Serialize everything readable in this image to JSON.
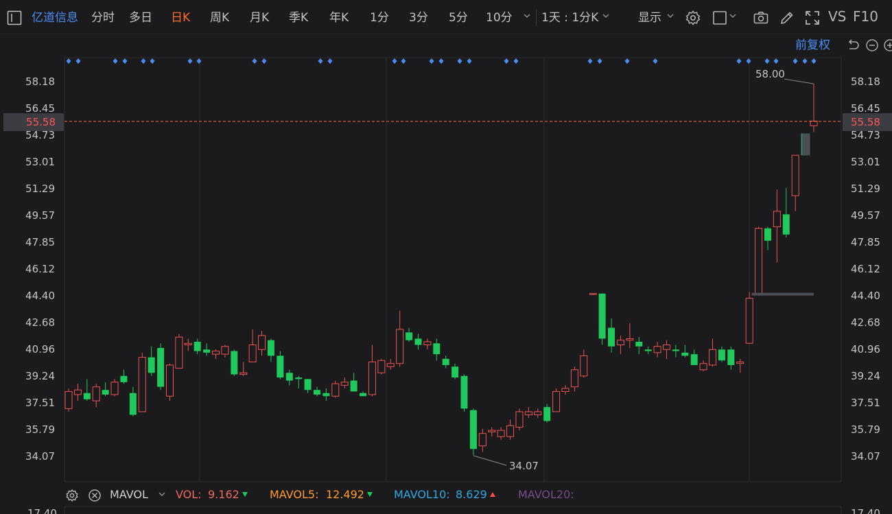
{
  "toolbar": {
    "stock_name": "亿道信息",
    "tabs": [
      "分时",
      "多日",
      "日K",
      "周K",
      "月K",
      "季K",
      "年K",
      "1分",
      "3分",
      "5分",
      "10分"
    ],
    "active_tab": "日K",
    "period_select": "1天 : 1分K",
    "display_label": "显示",
    "vs_label": "VS",
    "f10_label": "F10"
  },
  "chart": {
    "restore_label": "前复权",
    "current_price": "55.58",
    "high_annotation": "58.00",
    "low_annotation": "34.07",
    "y_ticks": [
      "58.18",
      "56.45",
      "54.73",
      "53.01",
      "51.29",
      "49.57",
      "47.85",
      "46.12",
      "44.40",
      "42.68",
      "40.96",
      "39.24",
      "37.51",
      "35.79",
      "34.07"
    ],
    "bottom_tick": "17.40"
  },
  "volume": {
    "indicator": "MAVOL",
    "vol_label": "VOL:",
    "vol_value": "9.162",
    "mavol5_label": "MAVOL5:",
    "mavol5_value": "12.492",
    "mavol10_label": "MAVOL10:",
    "mavol10_value": "8.629",
    "mavol20_label": "MAVOL20:"
  },
  "colors": {
    "up": "#ef5350",
    "down": "#1fc95b",
    "accent": "#ff6a28",
    "blue": "#4a8df2"
  },
  "chart_data": {
    "type": "candlestick",
    "y_range": [
      34.07,
      58.18
    ],
    "candles": [
      {
        "o": 37.1,
        "h": 38.4,
        "l": 36.9,
        "c": 38.2
      },
      {
        "o": 38.0,
        "h": 38.7,
        "l": 37.6,
        "c": 38.3
      },
      {
        "o": 38.1,
        "h": 39.0,
        "l": 37.6,
        "c": 37.7
      },
      {
        "o": 37.6,
        "h": 38.7,
        "l": 37.2,
        "c": 38.5
      },
      {
        "o": 38.3,
        "h": 38.8,
        "l": 37.9,
        "c": 38.0
      },
      {
        "o": 38.0,
        "h": 39.0,
        "l": 37.9,
        "c": 38.8
      },
      {
        "o": 39.2,
        "h": 39.6,
        "l": 38.7,
        "c": 38.8
      },
      {
        "o": 38.1,
        "h": 38.5,
        "l": 36.6,
        "c": 36.7
      },
      {
        "o": 36.9,
        "h": 40.7,
        "l": 36.9,
        "c": 40.4
      },
      {
        "o": 40.4,
        "h": 41.1,
        "l": 39.2,
        "c": 39.4
      },
      {
        "o": 41.0,
        "h": 41.3,
        "l": 38.3,
        "c": 38.5
      },
      {
        "o": 37.9,
        "h": 40.0,
        "l": 37.6,
        "c": 39.9
      },
      {
        "o": 39.7,
        "h": 41.9,
        "l": 39.7,
        "c": 41.7
      },
      {
        "o": 41.2,
        "h": 41.6,
        "l": 40.8,
        "c": 41.3
      },
      {
        "o": 41.4,
        "h": 41.6,
        "l": 40.6,
        "c": 40.8
      },
      {
        "o": 40.9,
        "h": 41.3,
        "l": 40.5,
        "c": 40.7
      },
      {
        "o": 40.6,
        "h": 40.9,
        "l": 40.3,
        "c": 40.8
      },
      {
        "o": 40.6,
        "h": 41.2,
        "l": 40.4,
        "c": 41.1
      },
      {
        "o": 40.8,
        "h": 40.9,
        "l": 39.2,
        "c": 39.3
      },
      {
        "o": 39.3,
        "h": 40.1,
        "l": 39.2,
        "c": 39.4
      },
      {
        "o": 40.1,
        "h": 42.2,
        "l": 40.1,
        "c": 41.2
      },
      {
        "o": 40.9,
        "h": 42.1,
        "l": 40.5,
        "c": 41.8
      },
      {
        "o": 41.5,
        "h": 41.6,
        "l": 40.1,
        "c": 40.5
      },
      {
        "o": 40.5,
        "h": 40.8,
        "l": 39.0,
        "c": 39.1
      },
      {
        "o": 39.4,
        "h": 39.6,
        "l": 38.6,
        "c": 38.9
      },
      {
        "o": 39.1,
        "h": 39.2,
        "l": 38.4,
        "c": 39.0
      },
      {
        "o": 39.0,
        "h": 39.0,
        "l": 38.1,
        "c": 38.3
      },
      {
        "o": 38.3,
        "h": 38.5,
        "l": 37.9,
        "c": 38.0
      },
      {
        "o": 38.1,
        "h": 38.4,
        "l": 37.6,
        "c": 37.9
      },
      {
        "o": 37.9,
        "h": 38.9,
        "l": 37.8,
        "c": 38.7
      },
      {
        "o": 38.6,
        "h": 39.1,
        "l": 38.4,
        "c": 38.8
      },
      {
        "o": 38.9,
        "h": 39.4,
        "l": 38.3,
        "c": 38.2
      },
      {
        "o": 38.1,
        "h": 38.2,
        "l": 37.9,
        "c": 37.9
      },
      {
        "o": 38.0,
        "h": 41.2,
        "l": 37.9,
        "c": 40.1
      },
      {
        "o": 39.4,
        "h": 40.3,
        "l": 39.3,
        "c": 40.2
      },
      {
        "o": 39.8,
        "h": 40.3,
        "l": 39.6,
        "c": 40.0
      },
      {
        "o": 40.0,
        "h": 43.4,
        "l": 39.8,
        "c": 42.2
      },
      {
        "o": 42.0,
        "h": 42.3,
        "l": 41.4,
        "c": 41.5
      },
      {
        "o": 41.6,
        "h": 41.9,
        "l": 40.9,
        "c": 41.2
      },
      {
        "o": 41.2,
        "h": 41.6,
        "l": 40.9,
        "c": 41.4
      },
      {
        "o": 41.3,
        "h": 41.6,
        "l": 40.2,
        "c": 40.6
      },
      {
        "o": 40.3,
        "h": 40.5,
        "l": 39.7,
        "c": 39.9
      },
      {
        "o": 39.8,
        "h": 40.0,
        "l": 39.0,
        "c": 39.1
      },
      {
        "o": 39.2,
        "h": 39.3,
        "l": 36.9,
        "c": 37.1
      },
      {
        "o": 37.0,
        "h": 37.1,
        "l": 34.1,
        "c": 34.5
      },
      {
        "o": 34.7,
        "h": 35.8,
        "l": 34.3,
        "c": 35.5
      },
      {
        "o": 35.6,
        "h": 35.9,
        "l": 35.3,
        "c": 35.7
      },
      {
        "o": 35.3,
        "h": 35.9,
        "l": 35.1,
        "c": 35.7
      },
      {
        "o": 35.3,
        "h": 36.4,
        "l": 35.1,
        "c": 36.0
      },
      {
        "o": 35.9,
        "h": 37.1,
        "l": 35.7,
        "c": 36.9
      },
      {
        "o": 36.7,
        "h": 37.2,
        "l": 36.5,
        "c": 36.9
      },
      {
        "o": 36.7,
        "h": 37.1,
        "l": 36.5,
        "c": 36.9
      },
      {
        "o": 37.2,
        "h": 37.4,
        "l": 36.2,
        "c": 36.3
      },
      {
        "o": 36.9,
        "h": 38.4,
        "l": 36.9,
        "c": 38.2
      },
      {
        "o": 38.2,
        "h": 38.6,
        "l": 38.0,
        "c": 38.4
      },
      {
        "o": 38.5,
        "h": 39.8,
        "l": 38.2,
        "c": 39.6
      },
      {
        "o": 39.2,
        "h": 40.9,
        "l": 39.1,
        "c": 40.5
      },
      {
        "o": 44.5,
        "h": 44.5,
        "l": 44.4,
        "c": 44.5
      },
      {
        "o": 44.5,
        "h": 44.5,
        "l": 41.2,
        "c": 41.6
      },
      {
        "o": 42.3,
        "h": 42.9,
        "l": 40.7,
        "c": 41.1
      },
      {
        "o": 41.2,
        "h": 41.8,
        "l": 40.6,
        "c": 41.5
      },
      {
        "o": 41.5,
        "h": 42.6,
        "l": 41.0,
        "c": 41.6
      },
      {
        "o": 41.4,
        "h": 41.7,
        "l": 40.6,
        "c": 41.1
      },
      {
        "o": 40.9,
        "h": 41.1,
        "l": 40.6,
        "c": 40.8
      },
      {
        "o": 40.7,
        "h": 41.4,
        "l": 40.4,
        "c": 41.1
      },
      {
        "o": 40.9,
        "h": 41.5,
        "l": 40.3,
        "c": 41.2
      },
      {
        "o": 40.9,
        "h": 41.2,
        "l": 40.4,
        "c": 40.8
      },
      {
        "o": 40.7,
        "h": 41.2,
        "l": 40.4,
        "c": 40.5
      },
      {
        "o": 40.6,
        "h": 40.9,
        "l": 39.9,
        "c": 39.9
      },
      {
        "o": 39.6,
        "h": 40.2,
        "l": 39.5,
        "c": 40.0
      },
      {
        "o": 39.9,
        "h": 41.6,
        "l": 39.8,
        "c": 40.9
      },
      {
        "o": 40.9,
        "h": 41.1,
        "l": 40.1,
        "c": 40.2
      },
      {
        "o": 40.9,
        "h": 41.1,
        "l": 39.6,
        "c": 39.9
      },
      {
        "o": 40.0,
        "h": 40.3,
        "l": 39.4,
        "c": 40.1
      },
      {
        "o": 41.3,
        "h": 44.6,
        "l": 41.3,
        "c": 44.2
      },
      {
        "o": 44.4,
        "h": 48.8,
        "l": 44.4,
        "c": 48.7
      },
      {
        "o": 48.7,
        "h": 48.8,
        "l": 47.3,
        "c": 47.9
      },
      {
        "o": 48.8,
        "h": 51.2,
        "l": 46.5,
        "c": 49.8
      },
      {
        "o": 49.6,
        "h": 51.3,
        "l": 48.1,
        "c": 48.3
      },
      {
        "o": 50.8,
        "h": 52.5,
        "l": 49.8,
        "c": 53.4
      },
      {
        "o": 54.8,
        "h": 54.8,
        "l": 53.4,
        "c": 53.4
      },
      {
        "o": 55.3,
        "h": 58.0,
        "l": 54.9,
        "c": 55.6
      }
    ]
  }
}
